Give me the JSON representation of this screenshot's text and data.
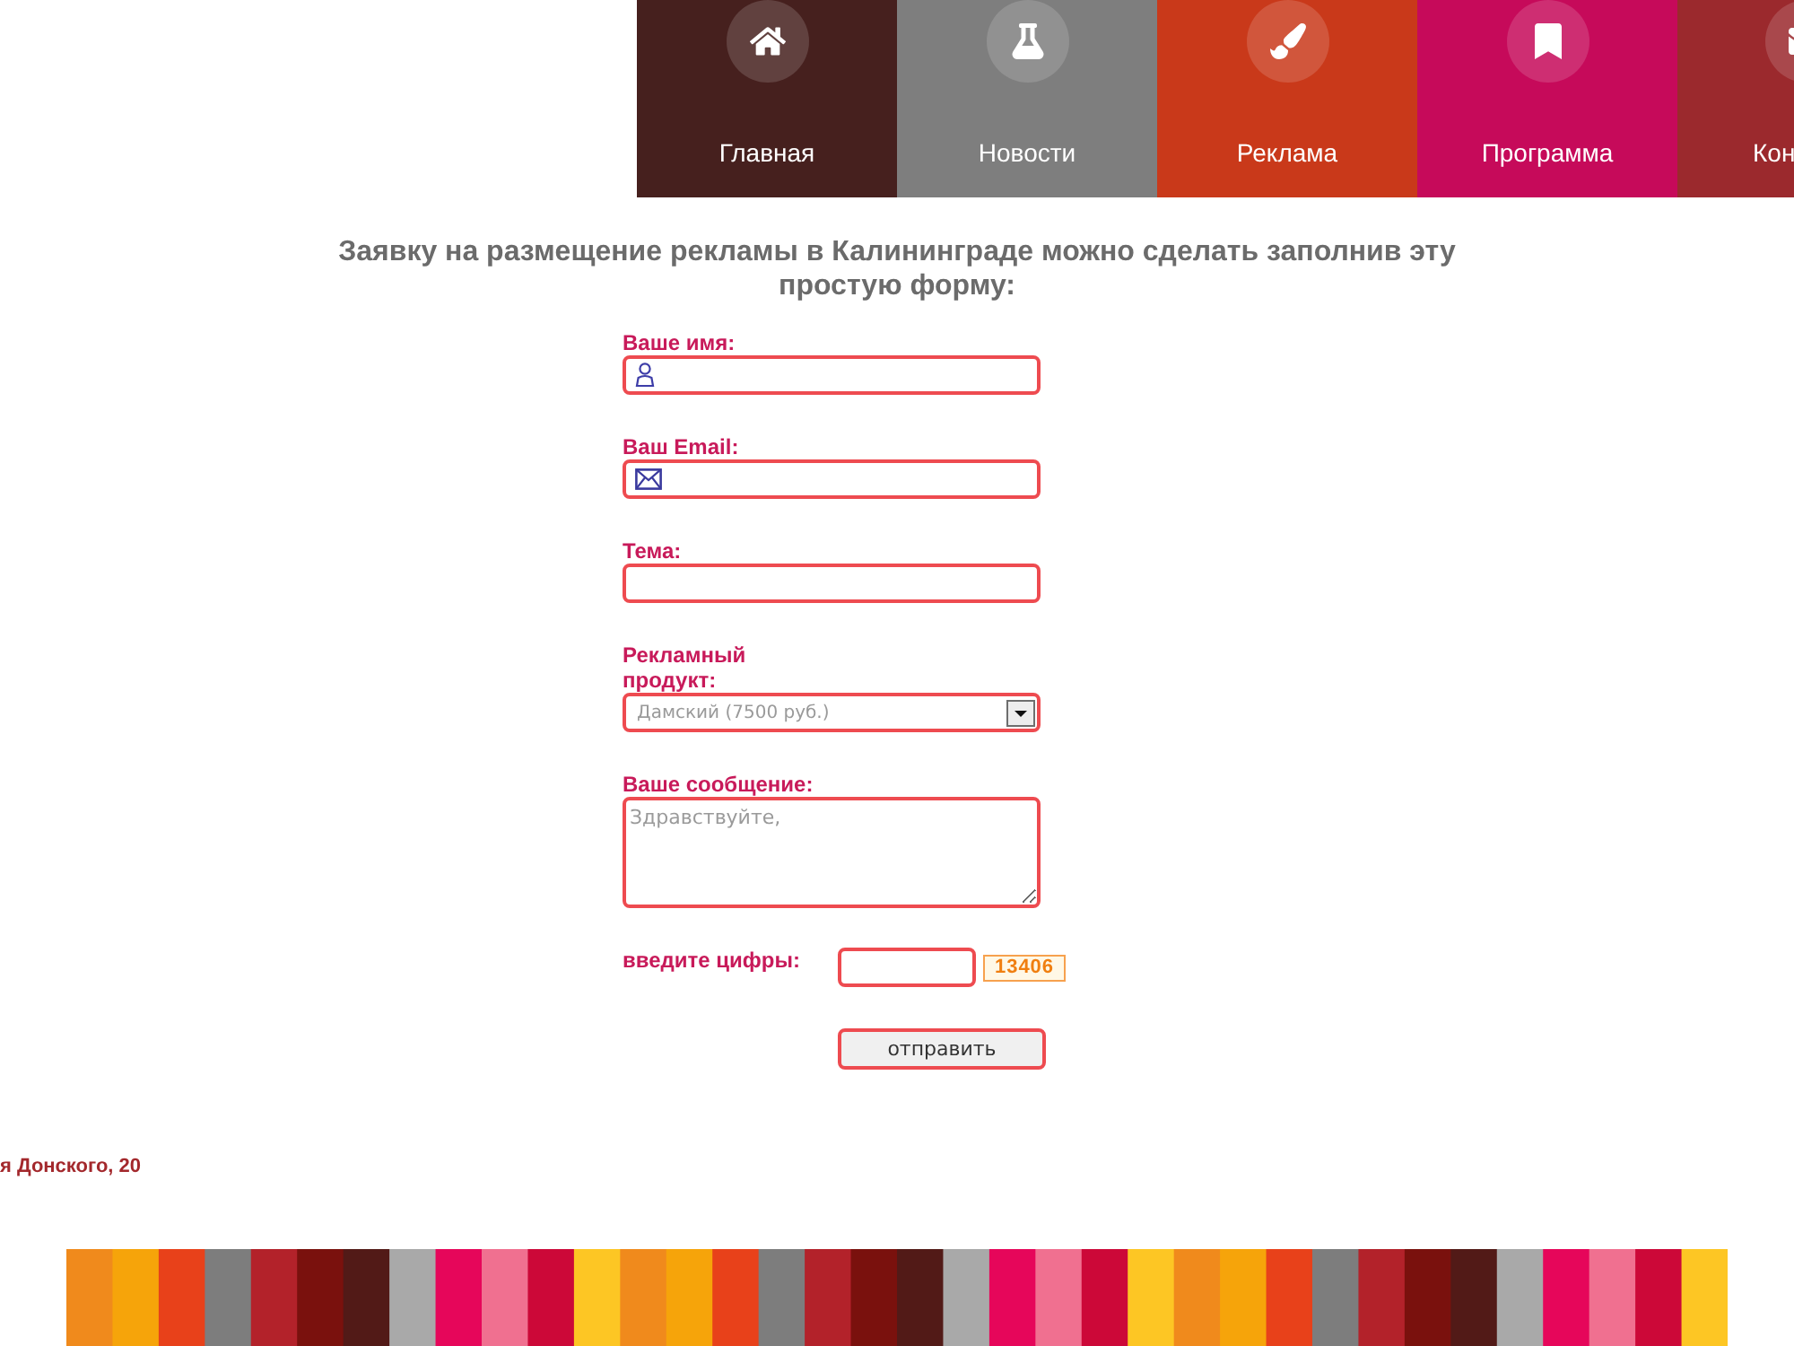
{
  "nav": {
    "items": [
      {
        "label": "Главная",
        "color": "#46201e"
      },
      {
        "label": "Новости",
        "color": "#7e7e7e"
      },
      {
        "label": "Реклама",
        "color": "#c9391a"
      },
      {
        "label": "Программа",
        "color": "#c60a5a"
      },
      {
        "label": "Кон",
        "color": "#9b292d"
      }
    ]
  },
  "heading": "Заявку на размещение рекламы в Калининграде можно сделать заполнив эту простую форму:",
  "form": {
    "fields": [
      {
        "kind": "name",
        "label": "Ваше имя:"
      },
      {
        "kind": "email",
        "label": "Ваш Email:"
      },
      {
        "kind": "text",
        "label": "Тема:"
      },
      {
        "kind": "select",
        "label": "Рекламный продукт:",
        "value": "Дамский (7500 руб.)"
      },
      {
        "kind": "textarea",
        "label": "Ваше сообщение:",
        "placeholder": "Здравствуйте,"
      }
    ],
    "captcha": {
      "label": "введите цифры:",
      "code": "13406"
    },
    "submit": "отправить"
  },
  "footer": {
    "address": "я Донского, 20"
  }
}
